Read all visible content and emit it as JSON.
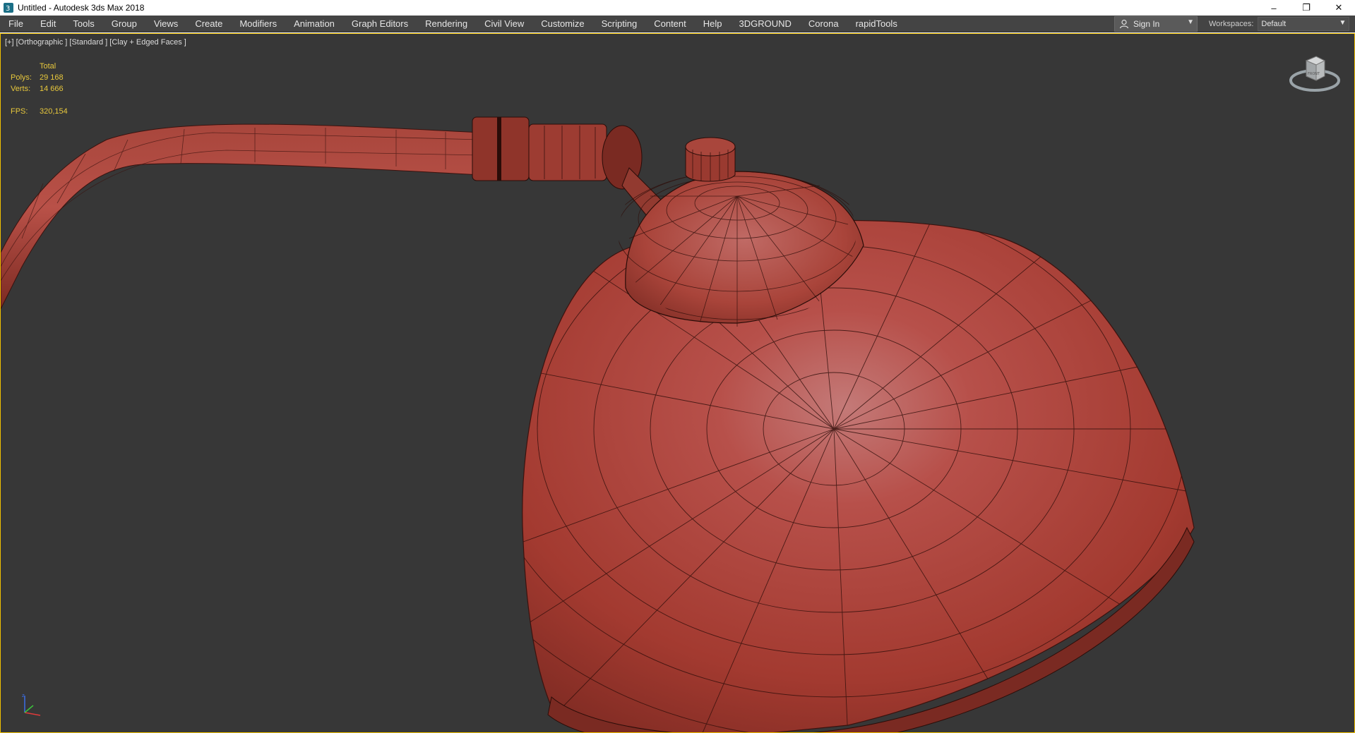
{
  "window": {
    "title": "Untitled - Autodesk 3ds Max 2018",
    "minimize_glyph": "–",
    "maximize_glyph": "❐",
    "close_glyph": "✕"
  },
  "menu": {
    "items": [
      {
        "label": "File",
        "icon": ""
      },
      {
        "label": "Edit"
      },
      {
        "label": "Tools"
      },
      {
        "label": "Group"
      },
      {
        "label": "Views"
      },
      {
        "label": "Create"
      },
      {
        "label": "Modifiers"
      },
      {
        "label": "Animation"
      },
      {
        "label": "Graph Editors"
      },
      {
        "label": "Rendering"
      },
      {
        "label": "Civil View"
      },
      {
        "label": "Customize"
      },
      {
        "label": "Scripting"
      },
      {
        "label": "Content"
      },
      {
        "label": "Help"
      },
      {
        "label": "3DGROUND"
      },
      {
        "label": "Corona"
      },
      {
        "label": "rapidTools"
      }
    ],
    "sign_in": "Sign In",
    "workspaces_label": "Workspaces:",
    "workspace_value": "Default"
  },
  "viewport": {
    "label": "[+] [Orthographic ] [Standard ] [Clay + Edged Faces ]",
    "stats": {
      "header": "Total",
      "polys_label": "Polys:",
      "polys_value": "29 168",
      "verts_label": "Verts:",
      "verts_value": "14 666",
      "fps_label": "FPS:",
      "fps_value": "320,154"
    },
    "viewcube_face": "FRONT"
  },
  "colors": {
    "accent_border": "#f0c000",
    "viewport_bg": "#373737",
    "clay": "#b5463a",
    "stats_text": "#e8c83c"
  }
}
